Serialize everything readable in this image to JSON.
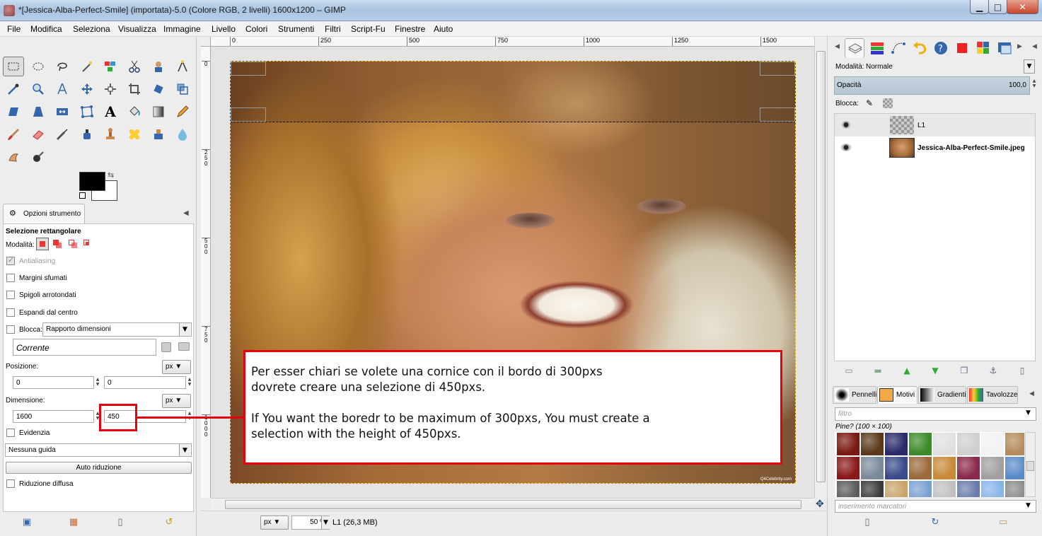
{
  "window": {
    "title": "*[Jessica-Alba-Perfect-Smile] (importata)-5.0 (Colore RGB, 2 livelli) 1600x1200 – GIMP",
    "minimize": "▁",
    "maximize": "□",
    "close": "✕"
  },
  "menu": [
    "File",
    "Modifica",
    "Seleziona",
    "Visualizza",
    "Immagine",
    "Livello",
    "Colori",
    "Strumenti",
    "Filtri",
    "Script-Fu",
    "Finestre",
    "Aiuto"
  ],
  "tool_options": {
    "tab_label": "Opzioni strumento",
    "tool_name": "Selezione rettangolare",
    "mode_label": "Modalità:",
    "antialias_label": "Antialiasing",
    "feather_label": "Margini sfumati",
    "rounded_label": "Spigoli arrotondati",
    "expand_label": "Espandi dal centro",
    "fixed_label": "Blocca:",
    "fixed_value": "Rapporto dimensioni",
    "current_value": "Corrente",
    "position_label": "Posizione:",
    "position_unit": "px",
    "pos_x": "0",
    "pos_y": "0",
    "size_label": "Dimensione:",
    "size_unit": "px",
    "width": "1600",
    "height": "450",
    "highlight_label": "Evidenzia",
    "guides_value": "Nessuna guida",
    "autoshrink_label": "Auto riduzione",
    "shrink_merged_label": "Riduzione diffusa"
  },
  "ruler": {
    "top_ticks": [
      "0",
      "250",
      "500",
      "750",
      "1000",
      "1250",
      "1500"
    ],
    "left_ticks": [
      "0",
      "250",
      "500",
      "750",
      "1000"
    ]
  },
  "canvas": {
    "photo_credit": "Q4Celebrity.com"
  },
  "status": {
    "unit": "px",
    "zoom": "50 %",
    "layer_info": "L1 (26,3 MB)"
  },
  "annotation": {
    "line1": "Per esser chiari se volete una cornice con il bordo di 300pxs",
    "line2": "dovrete creare una selezione di 450pxs.",
    "line3": "If You want the boredr to be maximum of 300pxs, You must create a",
    "line4": "selection with the height of 450pxs."
  },
  "layers": {
    "mode_label": "Modalità:",
    "mode_value": "Normale",
    "opacity_label": "Opacità",
    "opacity_value": "100,0",
    "lock_label": "Blocca:",
    "items": [
      {
        "name": "L1"
      },
      {
        "name": "Jessica-Alba-Perfect-Smile.jpeg"
      }
    ]
  },
  "patterns": {
    "tabs": [
      "Pennelli",
      "Motivi",
      "Gradienti",
      "Tavolozze"
    ],
    "filter_placeholder": "filtro",
    "current_pattern": "Pine? (100 × 100)",
    "tag_placeholder": "inserimento marcatori",
    "swatch_colors": [
      "#7a1a12",
      "#5a3a1a",
      "#2a2a6a",
      "#3c8a2a",
      "#e0e0e0",
      "#cfcfcf",
      "#f2f2f2",
      "#b48a5a",
      "#8a1a1a",
      "#7a8a9a",
      "#3a4a8a",
      "#9a6a3a",
      "#c88a3a",
      "#8a2a4a",
      "#a0a0a0",
      "#5a8ac8",
      "#5a5a5a",
      "#3a3a3a",
      "#c8a46a",
      "#7aa0d0",
      "#c0c0c0",
      "#6a7aaa",
      "#88b4e8",
      "#8a8a8a",
      "#e4a85a",
      "#d89a4a",
      "#efd8d0",
      "#eadfd5",
      "#6a8ac8",
      "#3a6aa8",
      "#a8c8f0",
      "#777"
    ]
  },
  "colors": {
    "accent_red": "#e3000f",
    "selection": "#111111",
    "image_border": "#f4d84a"
  }
}
